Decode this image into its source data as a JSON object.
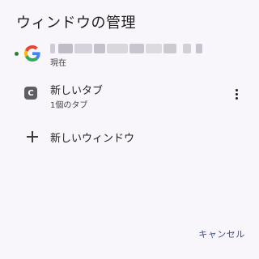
{
  "dialog": {
    "title": "ウィンドウの管理"
  },
  "window_entry": {
    "icon": "google-g-icon",
    "name_redacted": true,
    "subtitle": "現在",
    "current_indicator_color": "#2e7d32"
  },
  "tab_entry": {
    "favicon_letter": "C",
    "title": "新しいタブ",
    "subtitle": "1個のタブ",
    "menu_icon": "more-vert-icon"
  },
  "actions": {
    "new_window_label": "新しいウィンドウ",
    "new_window_icon": "plus-icon",
    "cancel_label": "キャンセル"
  },
  "colors": {
    "background": "#f8f6fb",
    "accent": "#3a4a8c",
    "text": "#1f1f1f"
  }
}
